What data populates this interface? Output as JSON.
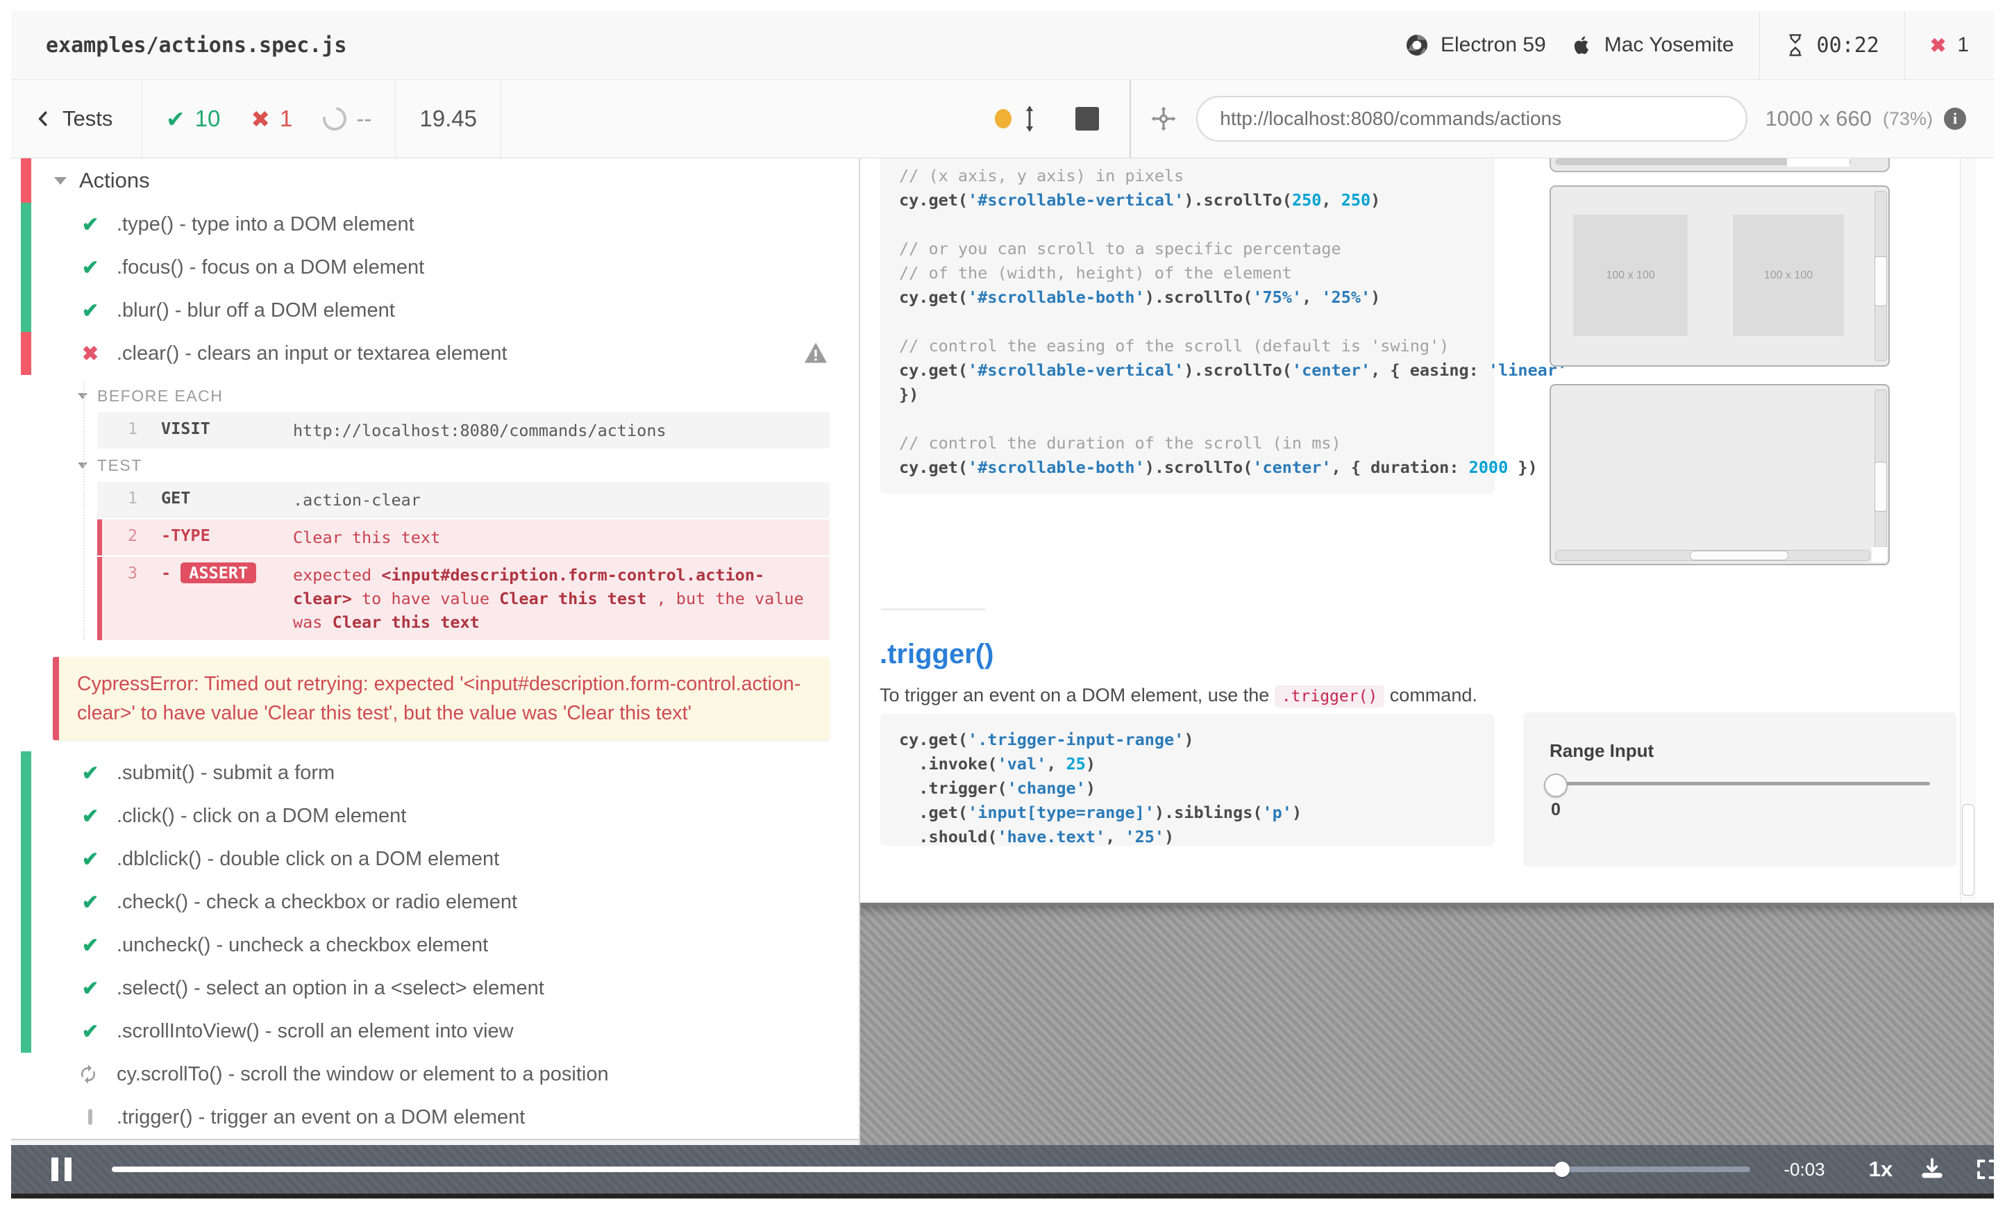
{
  "header": {
    "spec": "examples/actions.spec.js",
    "browser": "Electron 59",
    "os": "Mac Yosemite",
    "timer": "00:22",
    "failures": "1"
  },
  "toolbar": {
    "back_label": "Tests",
    "passed": "10",
    "failed": "1",
    "pending": "--",
    "duration": "19.45",
    "url": "http://localhost:8080/commands/actions",
    "viewport_size": "1000 x 660",
    "viewport_zoom": "(73%)"
  },
  "reporter": {
    "suite": "Actions",
    "tests_before": [
      {
        "status": "passed",
        "strip": "green",
        "label": ".type() - type into a DOM element"
      },
      {
        "status": "passed",
        "strip": "green",
        "label": ".focus() - focus on a DOM element"
      },
      {
        "status": "passed",
        "strip": "green",
        "label": ".blur() - blur off a DOM element"
      },
      {
        "status": "failed",
        "strip": "red",
        "label": ".clear() - clears an input or textarea element",
        "warn": true
      }
    ],
    "hooks": [
      {
        "title": "BEFORE EACH",
        "commands": [
          {
            "n": "1",
            "name": "VISIT",
            "message": "http://localhost:8080/commands/actions",
            "state": "normal"
          }
        ]
      },
      {
        "title": "TEST",
        "commands": [
          {
            "n": "1",
            "name": "GET",
            "message": ".action-clear",
            "state": "normal"
          },
          {
            "n": "2",
            "name": "TYPE",
            "dash": true,
            "message": "Clear this text",
            "state": "failed"
          },
          {
            "n": "3",
            "name": "ASSERT",
            "dash": true,
            "badge": true,
            "state": "failed",
            "parts": [
              [
                "p",
                "expected "
              ],
              [
                "b",
                "<input#description.form-control.action-clear>"
              ],
              [
                "p",
                " to have value "
              ],
              [
                "b",
                "Clear this test"
              ],
              [
                "p",
                " , but the value was "
              ],
              [
                "b",
                "Clear this text"
              ]
            ]
          }
        ]
      }
    ],
    "error": "CypressError: Timed out retrying: expected '<input#description.form-control.action-clear>' to have value 'Clear this test', but the value was 'Clear this text'",
    "tests_after": [
      {
        "status": "passed",
        "strip": "green",
        "label": ".submit() - submit a form"
      },
      {
        "status": "passed",
        "strip": "green",
        "label": ".click() - click on a DOM element"
      },
      {
        "status": "passed",
        "strip": "green",
        "label": ".dblclick() - double click on a DOM element"
      },
      {
        "status": "passed",
        "strip": "green",
        "label": ".check() - check a checkbox or radio element"
      },
      {
        "status": "passed",
        "strip": "green",
        "label": ".uncheck() - uncheck a checkbox element"
      },
      {
        "status": "passed",
        "strip": "green",
        "label": ".select() - select an option in a <select> element"
      },
      {
        "status": "passed",
        "strip": "green",
        "label": ".scrollIntoView() - scroll an element into view"
      },
      {
        "status": "running",
        "strip": "none",
        "label": "cy.scrollTo() - scroll the window or element to a position"
      },
      {
        "status": "pending",
        "strip": "none",
        "label": ".trigger() - trigger an event on a DOM element"
      }
    ]
  },
  "aut": {
    "code1": [
      [
        [
          "c",
          "// (x axis, y axis) in pixels"
        ]
      ],
      [
        [
          "p",
          "cy.get("
        ],
        [
          "s",
          "'#scrollable-vertical'"
        ],
        [
          "p",
          ").scrollTo("
        ],
        [
          "n",
          "250"
        ],
        [
          "p",
          ", "
        ],
        [
          "n",
          "250"
        ],
        [
          "p",
          ")"
        ]
      ],
      [],
      [
        [
          "c",
          "// or you can scroll to a specific percentage"
        ]
      ],
      [
        [
          "c",
          "// of the (width, height) of the element"
        ]
      ],
      [
        [
          "p",
          "cy.get("
        ],
        [
          "s",
          "'#scrollable-both'"
        ],
        [
          "p",
          ").scrollTo("
        ],
        [
          "s",
          "'75%'"
        ],
        [
          "p",
          ", "
        ],
        [
          "s",
          "'25%'"
        ],
        [
          "p",
          ")"
        ]
      ],
      [],
      [
        [
          "c",
          "// control the easing of the scroll (default is 'swing')"
        ]
      ],
      [
        [
          "p",
          "cy.get("
        ],
        [
          "s",
          "'#scrollable-vertical'"
        ],
        [
          "p",
          ").scrollTo("
        ],
        [
          "s",
          "'center'"
        ],
        [
          "p",
          ", { easing: "
        ],
        [
          "s",
          "'linear'"
        ]
      ],
      [
        [
          "p",
          "})"
        ]
      ],
      [],
      [
        [
          "c",
          "// control the duration of the scroll (in ms)"
        ]
      ],
      [
        [
          "p",
          "cy.get("
        ],
        [
          "s",
          "'#scrollable-both'"
        ],
        [
          "p",
          ").scrollTo("
        ],
        [
          "s",
          "'center'"
        ],
        [
          "p",
          ", { duration: "
        ],
        [
          "n",
          "2000"
        ],
        [
          "p",
          " })"
        ]
      ]
    ],
    "box_label_1": "100 x 100",
    "box_label_2": "100 x 100",
    "trigger_heading": ".trigger()",
    "trigger_desc_pre": "To trigger an event on a DOM element, use the ",
    "trigger_desc_code": ".trigger()",
    "trigger_desc_post": " command.",
    "code2": [
      [
        [
          "p",
          "cy.get("
        ],
        [
          "s",
          "'.trigger-input-range'"
        ],
        [
          "p",
          ")"
        ]
      ],
      [
        [
          "p",
          "  .invoke("
        ],
        [
          "s",
          "'val'"
        ],
        [
          "p",
          ", "
        ],
        [
          "n",
          "25"
        ],
        [
          "p",
          ")"
        ]
      ],
      [
        [
          "p",
          "  .trigger("
        ],
        [
          "s",
          "'change'"
        ],
        [
          "p",
          ")"
        ]
      ],
      [
        [
          "p",
          "  .get("
        ],
        [
          "s",
          "'input[type=range]'"
        ],
        [
          "p",
          ").siblings("
        ],
        [
          "s",
          "'p'"
        ],
        [
          "p",
          ")"
        ]
      ],
      [
        [
          "p",
          "  .should("
        ],
        [
          "s",
          "'have.text'"
        ],
        [
          "p",
          ", "
        ],
        [
          "s",
          "'25'"
        ],
        [
          "p",
          ")"
        ]
      ]
    ],
    "range_label": "Range Input",
    "range_value": "0"
  },
  "player": {
    "remaining": "-0:03",
    "speed": "1x"
  }
}
